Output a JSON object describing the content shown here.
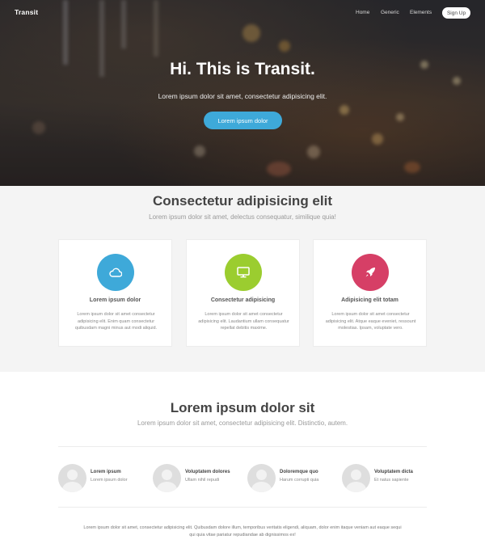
{
  "nav": {
    "brand": "Transit",
    "links": [
      "Home",
      "Generic",
      "Elements"
    ],
    "signup": "Sign Up"
  },
  "hero": {
    "title": "Hi. This is Transit.",
    "subtitle": "Lorem ipsum dolor sit amet, consectetur adipisicing elit.",
    "button": "Lorem ipsum dolor"
  },
  "features": {
    "title": "Consectetur adipisicing elit",
    "subtitle": "Lorem ipsum dolor sit amet, delectus consequatur, similique quia!",
    "cards": [
      {
        "icon": "cloud-icon",
        "color": "#3ea9d9",
        "title": "Lorem ipsum dolor",
        "text": "Lorem ipsum dolor sit amet consectetur adipisicing elit. Enim quam consectetur quibusdam magni minus aut modi aliquid."
      },
      {
        "icon": "monitor-icon",
        "color": "#9bcd2f",
        "title": "Consectetur adipisicing",
        "text": "Lorem ipsum dolor sit amet consectetur adipisicing elit. Laudantium ullam consequatur repellat debitis maxime."
      },
      {
        "icon": "rocket-icon",
        "color": "#d63f66",
        "title": "Adipisicing elit totam",
        "text": "Lorem ipsum dolor sit amet consectetur adipisicing elit. Atque eaque eveniet, ressount molestias. Ipsam, voluptate vero."
      }
    ]
  },
  "section2": {
    "title": "Lorem ipsum dolor sit",
    "subtitle": "Lorem ipsum dolor sit amet, consectetur adipisicing elit. Distinctio, autem.",
    "people": [
      {
        "name": "Lorem ipsum",
        "role": "Lorem ipsum dolor"
      },
      {
        "name": "Voluptatem dolores",
        "role": "Ullam nihil repudi"
      },
      {
        "name": "Doloremque quo",
        "role": "Harum corrupti quia"
      },
      {
        "name": "Voluptatem dicta",
        "role": "Et natus sapiente"
      }
    ],
    "footer": "Lorem ipsum dolor sit amet, consectetur adipisicing elit. Quibusdam dolore illum, temporibus veritatis eligendi, aliquam, dolor enim itaque veniam aut eaque sequi qui quia vitae pariatur repudiandae ab dignissimos ex!"
  }
}
